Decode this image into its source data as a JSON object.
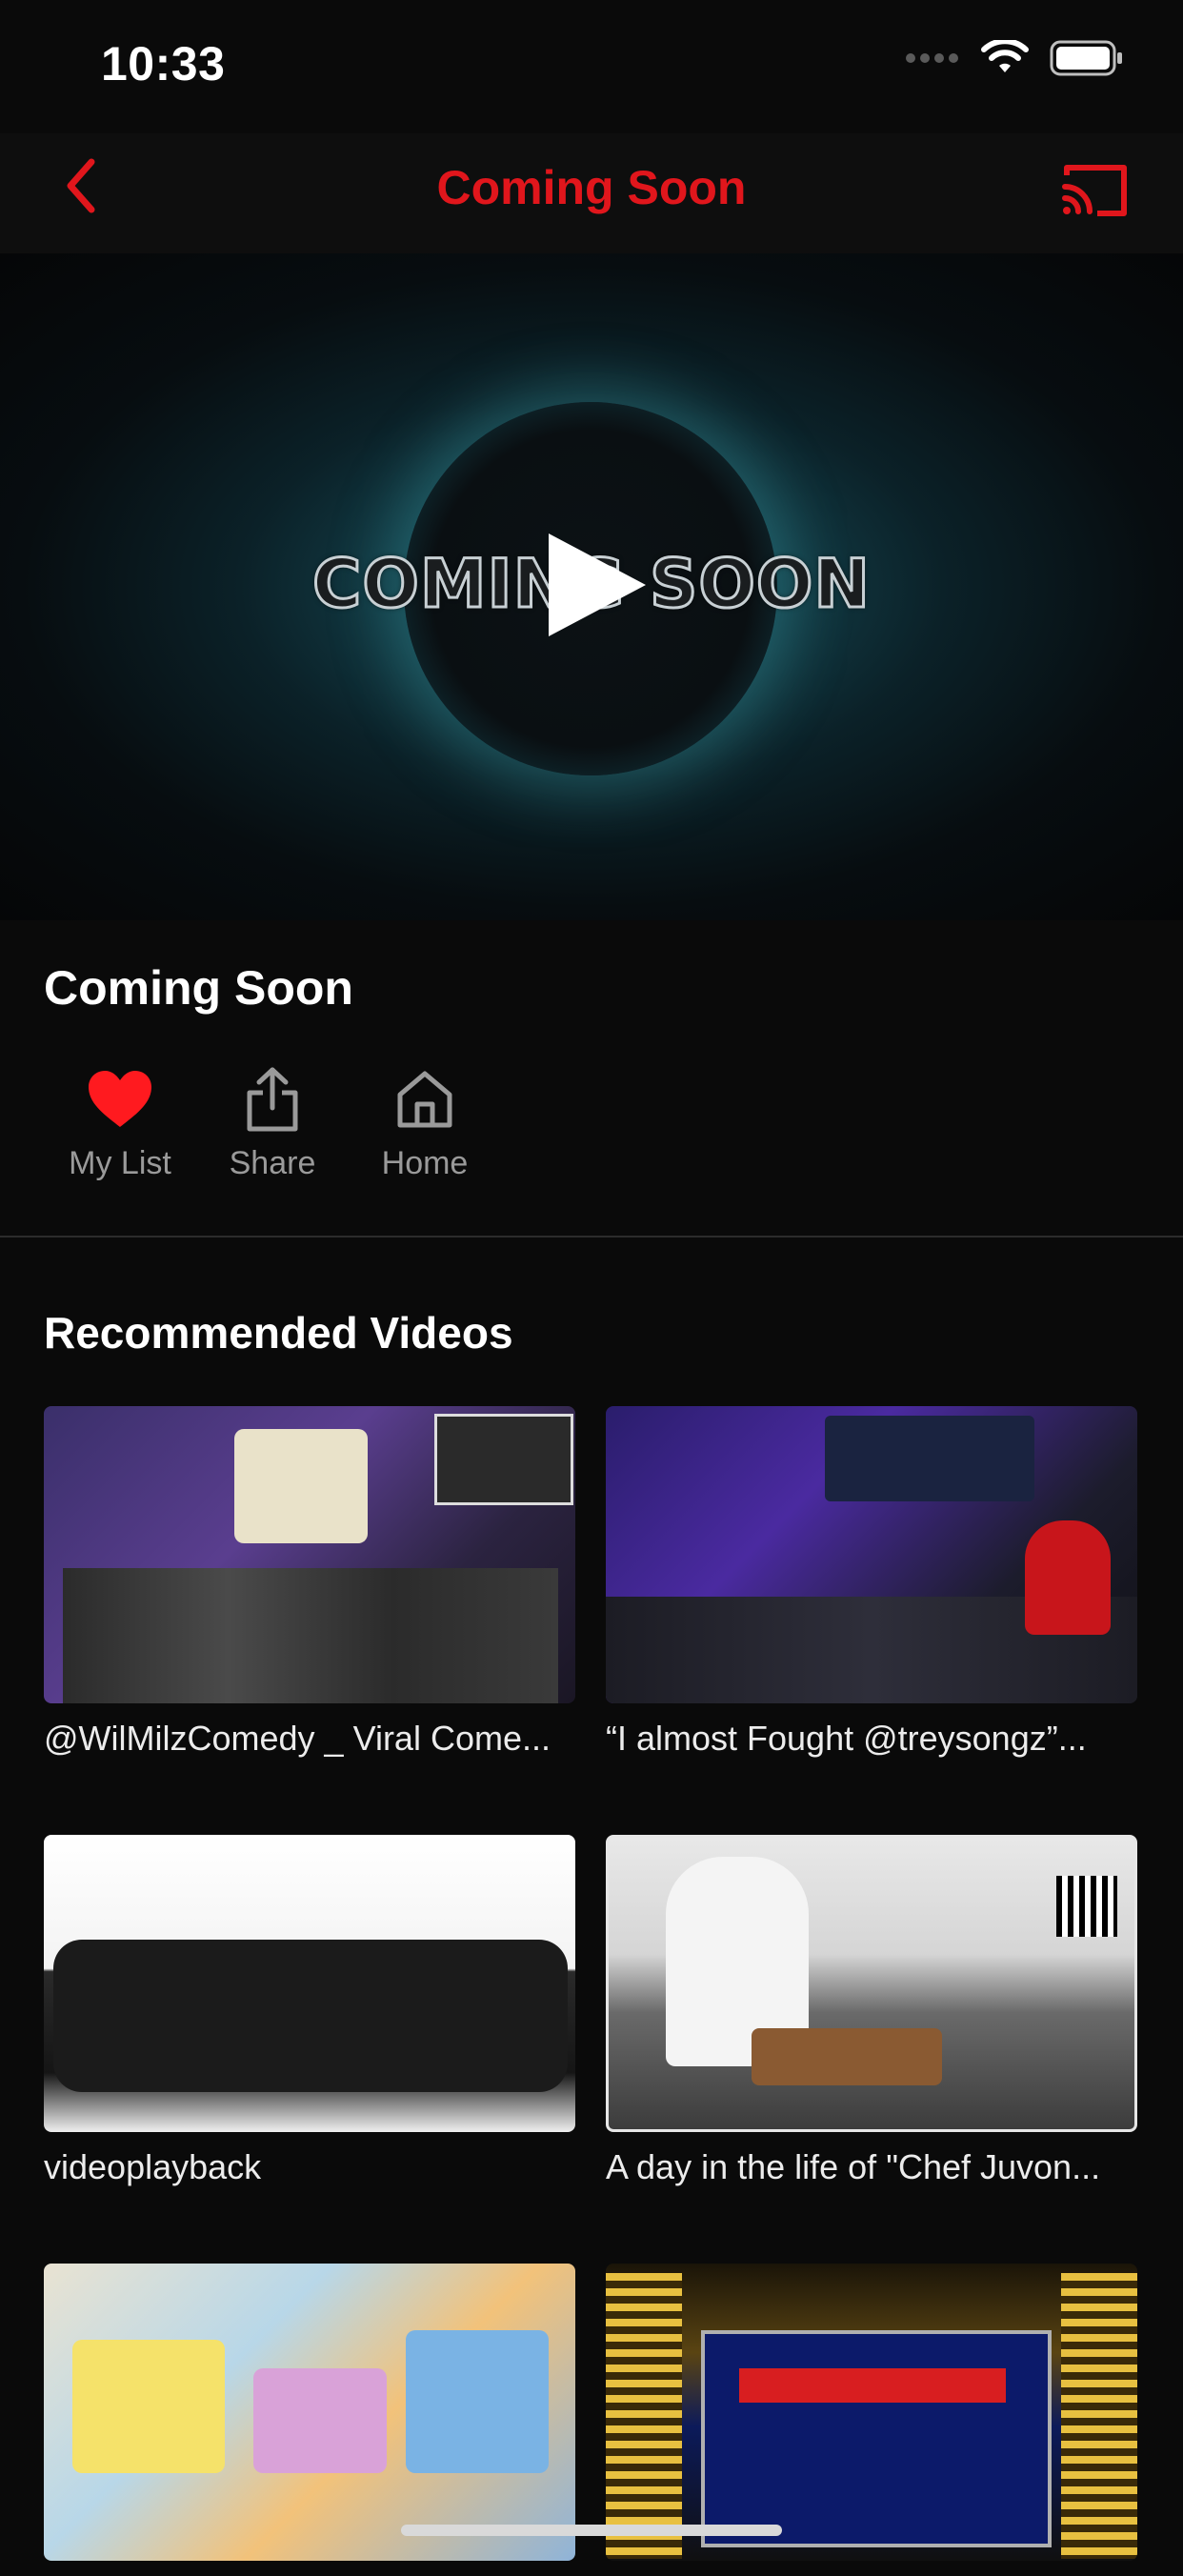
{
  "status_bar": {
    "time": "10:33"
  },
  "nav": {
    "title": "Coming Soon",
    "accent_color": "#e0161c",
    "back_icon": "chevron-left-icon",
    "cast_icon": "cast-icon"
  },
  "hero": {
    "overlay_text": "COMING SOON",
    "play_icon": "play-icon"
  },
  "video": {
    "title": "Coming Soon"
  },
  "actions": [
    {
      "label": "My List",
      "icon": "heart-icon",
      "active": true
    },
    {
      "label": "Share",
      "icon": "share-icon",
      "active": false
    },
    {
      "label": "Home",
      "icon": "home-icon",
      "active": false
    }
  ],
  "recommended": {
    "heading": "Recommended Videos",
    "items": [
      {
        "title": "@WilMilzComedy _ Viral Come..."
      },
      {
        "title": "“I almost Fought @treysongz”..."
      },
      {
        "title": "videoplayback"
      },
      {
        "title": "A day in the life of \"Chef Juvon..."
      },
      {
        "title": ""
      },
      {
        "title": ""
      }
    ]
  }
}
